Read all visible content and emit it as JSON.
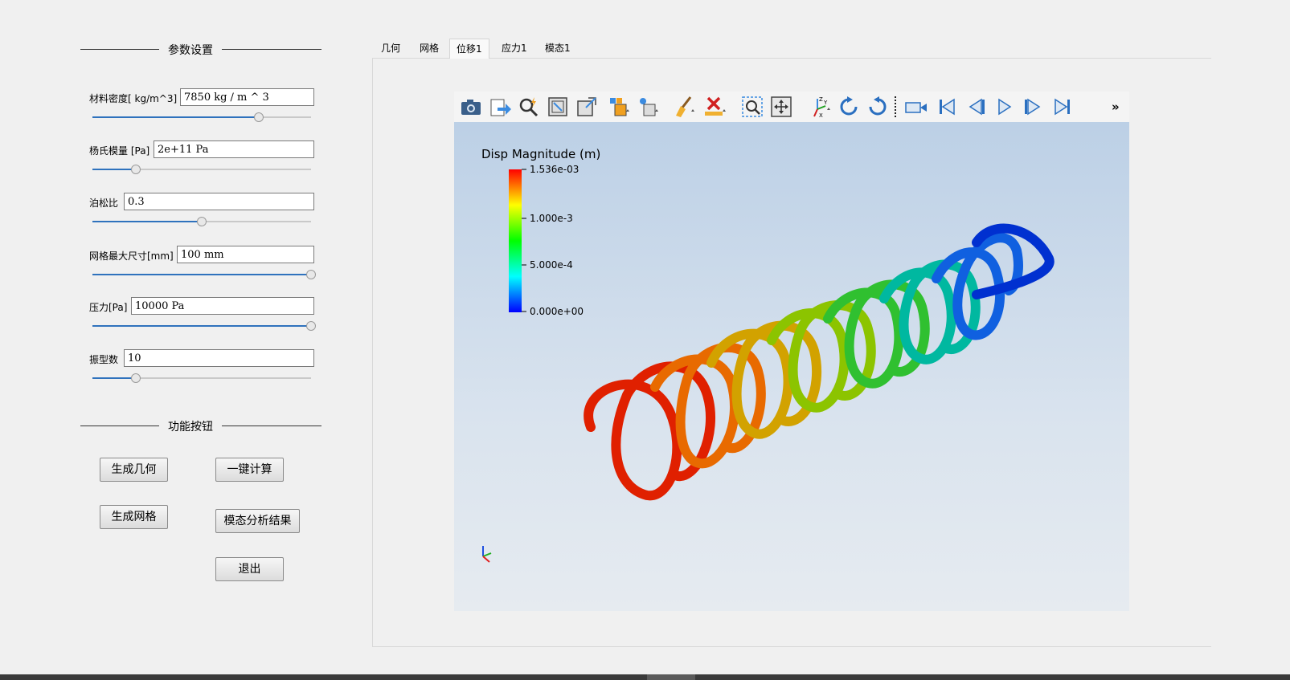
{
  "params_section": {
    "title": "参数设置",
    "rows": [
      {
        "label": "材料密度[ kg/m^3]",
        "value": "7850 kg / m ^ 3",
        "slider_level": 0.76
      },
      {
        "label": "杨氏模量 [Pa]",
        "value": "2e+11 Pa",
        "slider_level": 0.2
      },
      {
        "label": "泊松比",
        "value": "0.3",
        "slider_level": 0.5
      },
      {
        "label": "网格最大尺寸[mm]",
        "value": "100 mm",
        "slider_level": 1.0
      },
      {
        "label": "压力[Pa]",
        "value": "10000 Pa",
        "slider_level": 1.0
      },
      {
        "label": "振型数",
        "value": "10",
        "slider_level": 0.2
      }
    ]
  },
  "functions_section": {
    "title": "功能按钮",
    "buttons": {
      "gen_geometry": "生成几何",
      "one_click_compute": "一键计算",
      "gen_mesh": "生成网格",
      "modal_results": "模态分析结果",
      "exit": "退出"
    }
  },
  "tabs": [
    {
      "label": "几何",
      "active": false
    },
    {
      "label": "网格",
      "active": false
    },
    {
      "label": "位移1",
      "active": true
    },
    {
      "label": "应力1",
      "active": false
    },
    {
      "label": "模态1",
      "active": false
    }
  ],
  "toolbar": {
    "icons": [
      "camera-icon",
      "export-icon",
      "query-icon",
      "reset-view-icon",
      "zoom-extent-icon",
      "select-cells-icon",
      "select-points-icon",
      "brush-icon",
      "clear-selection-icon",
      "zoom-box-icon",
      "pan-icon",
      "axes-orientation-icon",
      "rotate-cw-icon",
      "rotate-ccw-icon",
      "video-camera-icon",
      "first-frame-icon",
      "prev-frame-icon",
      "play-icon",
      "next-frame-icon",
      "last-frame-icon"
    ],
    "overflow_label": "»"
  },
  "viewport": {
    "legend": {
      "title": "Disp Magnitude (m)",
      "ticks": [
        "1.536e-03",
        "1.000e-3",
        "5.000e-4",
        "0.000e+00"
      ]
    },
    "colors": {
      "background_top": "#bcd0e6",
      "background_bottom": "#e6ebf0",
      "min": "#0000ff",
      "max": "#ff0000"
    }
  }
}
